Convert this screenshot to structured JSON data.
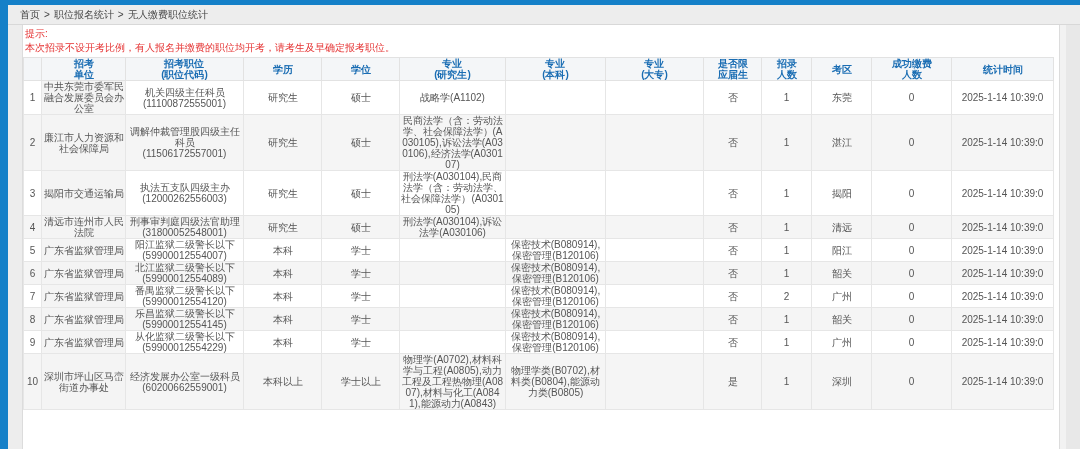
{
  "breadcrumb": [
    "首页",
    "职位报名统计",
    "无人缴费职位统计"
  ],
  "breadcrumb_separators": [
    ">",
    ">"
  ],
  "notice": {
    "title": "提示:",
    "text": "本次招录不设开考比例，有人报名并缴费的职位均开考，请考生及早确定报考职位。"
  },
  "table": {
    "columns": [
      {
        "label": "招考单位"
      },
      {
        "label": "招考职位\n(职位代码)"
      },
      {
        "label": "学历"
      },
      {
        "label": "学位"
      },
      {
        "label": "专业\n(研究生)"
      },
      {
        "label": "专业\n(本科)"
      },
      {
        "label": "专业\n(大专)"
      },
      {
        "label": "是否限应届生"
      },
      {
        "label": "招录人数"
      },
      {
        "label": "考区"
      },
      {
        "label": "成功缴费人数"
      },
      {
        "label": "统计时间"
      }
    ],
    "rows": [
      {
        "index": "1",
        "unit": "中共东莞市委军民融合发展委员会办公室",
        "position": "机关四级主任科员\n(11100872555001)",
        "education": "研究生",
        "degree": "硕士",
        "major_graduate": "战略学(A1102)",
        "fresh_only": "否",
        "quota": "1",
        "exam_area": "东莞",
        "paid": "0",
        "time": "2025-1-14 10:39:0"
      },
      {
        "index": "2",
        "unit": "廉江市人力资源和社会保障局",
        "position": "调解仲裁管理股四级主任科员\n(11506172557001)",
        "education": "研究生",
        "degree": "硕士",
        "major_graduate": "民商法学（含：劳动法学、社会保障法学）(A030105),诉讼法学(A030106),经济法学(A030107)",
        "fresh_only": "否",
        "quota": "1",
        "exam_area": "湛江",
        "paid": "0",
        "time": "2025-1-14 10:39:0"
      },
      {
        "index": "3",
        "unit": "揭阳市交通运输局",
        "position": "执法五支队四级主办\n(12000262556003)",
        "education": "研究生",
        "degree": "硕士",
        "major_graduate": "刑法学(A030104),民商法学（含：劳动法学、社会保障法学）(A030105)",
        "fresh_only": "否",
        "quota": "1",
        "exam_area": "揭阳",
        "paid": "0",
        "time": "2025-1-14 10:39:0"
      },
      {
        "index": "4",
        "unit": "清远市连州市人民法院",
        "position": "刑事审判庭四级法官助理\n(31800052548001)",
        "education": "研究生",
        "degree": "硕士",
        "major_graduate": "刑法学(A030104),诉讼法学(A030106)",
        "fresh_only": "否",
        "quota": "1",
        "exam_area": "清远",
        "paid": "0",
        "time": "2025-1-14 10:39:0"
      },
      {
        "index": "5",
        "unit": "广东省监狱管理局",
        "position": "阳江监狱二级警长以下\n(59900012554007)",
        "education": "本科",
        "degree": "学士",
        "major_undergraduate": "保密技术(B080914),保密管理(B120106)",
        "fresh_only": "否",
        "quota": "1",
        "exam_area": "阳江",
        "paid": "0",
        "time": "2025-1-14 10:39:0"
      },
      {
        "index": "6",
        "unit": "广东省监狱管理局",
        "position": "北江监狱二级警长以下\n(59900012554089)",
        "education": "本科",
        "degree": "学士",
        "major_undergraduate": "保密技术(B080914),保密管理(B120106)",
        "fresh_only": "否",
        "quota": "1",
        "exam_area": "韶关",
        "paid": "0",
        "time": "2025-1-14 10:39:0"
      },
      {
        "index": "7",
        "unit": "广东省监狱管理局",
        "position": "番禺监狱二级警长以下\n(59900012554120)",
        "education": "本科",
        "degree": "学士",
        "major_undergraduate": "保密技术(B080914),保密管理(B120106)",
        "fresh_only": "否",
        "quota": "2",
        "exam_area": "广州",
        "paid": "0",
        "time": "2025-1-14 10:39:0"
      },
      {
        "index": "8",
        "unit": "广东省监狱管理局",
        "position": "乐昌监狱二级警长以下\n(59900012554145)",
        "education": "本科",
        "degree": "学士",
        "major_undergraduate": "保密技术(B080914),保密管理(B120106)",
        "fresh_only": "否",
        "quota": "1",
        "exam_area": "韶关",
        "paid": "0",
        "time": "2025-1-14 10:39:0"
      },
      {
        "index": "9",
        "unit": "广东省监狱管理局",
        "position": "从化监狱二级警长以下\n(59900012554229)",
        "education": "本科",
        "degree": "学士",
        "major_undergraduate": "保密技术(B080914),保密管理(B120106)",
        "fresh_only": "否",
        "quota": "1",
        "exam_area": "广州",
        "paid": "0",
        "time": "2025-1-14 10:39:0"
      },
      {
        "index": "10",
        "unit": "深圳市坪山区马峦街道办事处",
        "position": "经济发展办公室一级科员\n(60200662559001)",
        "education": "本科以上",
        "degree": "学士以上",
        "major_graduate": "物理学(A0702),材料科学与工程(A0805),动力工程及工程热物理(A0807),材料与化工(A0841),能源动力(A0843)",
        "major_undergraduate": "物理学类(B0702),材料类(B0804),能源动力类(B0805)",
        "fresh_only": "是",
        "quota": "1",
        "exam_area": "深圳",
        "paid": "0",
        "time": "2025-1-14 10:39:0"
      }
    ]
  }
}
